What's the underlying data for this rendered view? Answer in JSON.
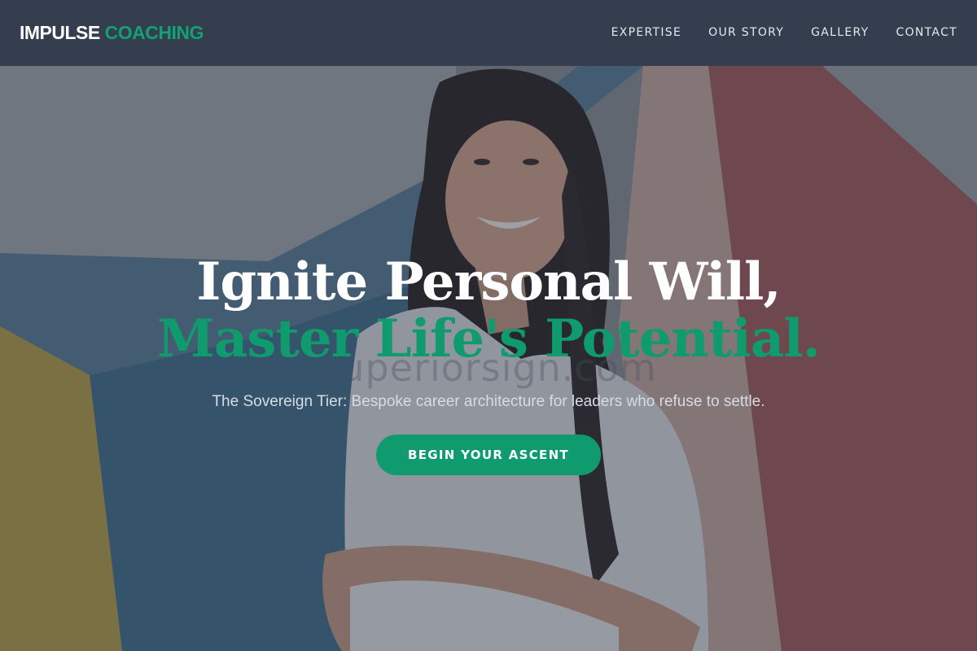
{
  "brand": {
    "name_part1": "IMPULSE",
    "name_part2": "COACHING",
    "accent_color": "#12a173"
  },
  "nav": {
    "items": [
      {
        "label": "EXPERTISE"
      },
      {
        "label": "OUR STORY"
      },
      {
        "label": "GALLERY"
      },
      {
        "label": "CONTACT"
      }
    ]
  },
  "hero": {
    "headline_line1": "Ignite Personal Will,",
    "headline_line2": "Master Life's Potential.",
    "subtitle": "The Sovereign Tier: Bespoke career architecture for leaders who refuse to settle.",
    "cta_label": "BEGIN YOUR ASCENT",
    "watermark": "superiorsign.com",
    "image_subject": "smiling woman with long dark hair in white shirt, arms crossed, in front of colorful geometric wall"
  },
  "colors": {
    "header_bg": "#343e4e",
    "accent": "#0f9b6d",
    "text_light": "#ffffff"
  }
}
